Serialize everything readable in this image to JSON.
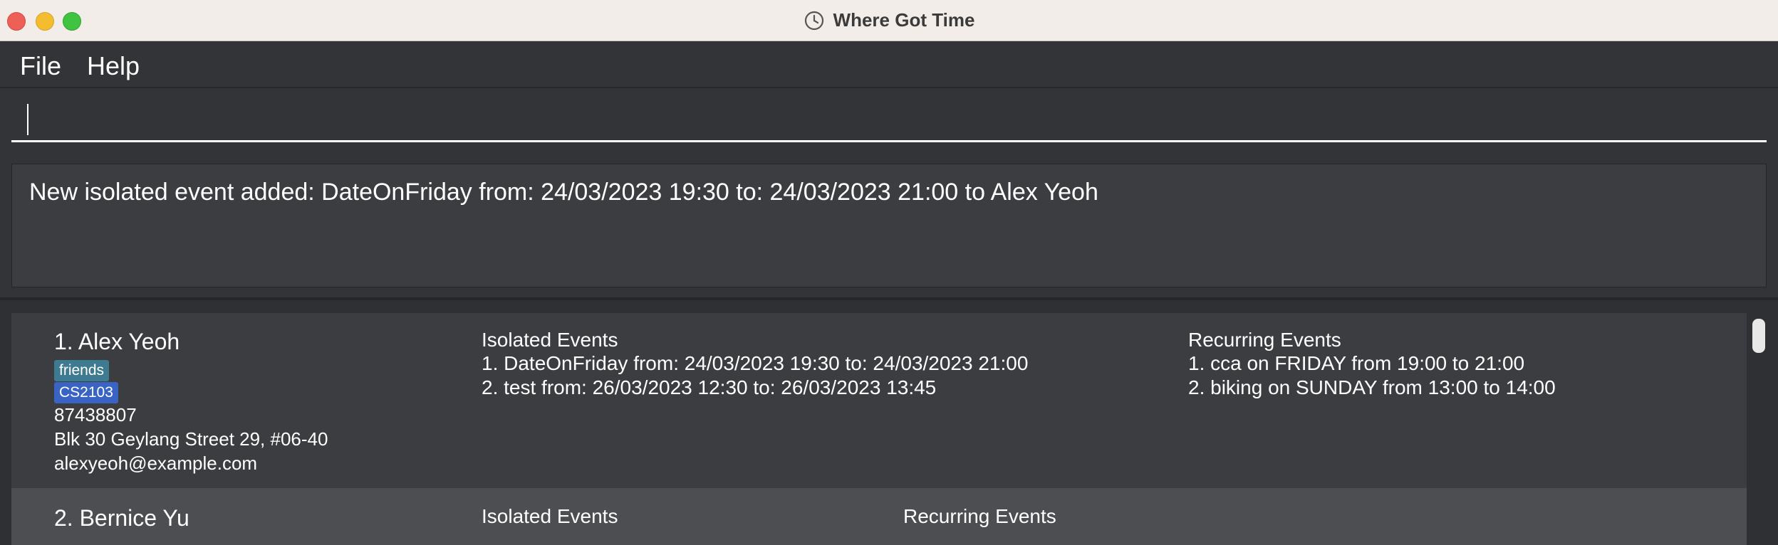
{
  "window": {
    "title": "Where Got Time",
    "icon": "clock-icon",
    "controls": [
      "close",
      "minimize",
      "maximize"
    ]
  },
  "menu": {
    "file": "File",
    "help": "Help"
  },
  "command": {
    "value": ""
  },
  "result": {
    "message": "New isolated event added: DateOnFriday from: 24/03/2023 19:30 to: 24/03/2023 21:00 to Alex Yeoh"
  },
  "persons": [
    {
      "name": "1. Alex Yeoh",
      "tags": [
        "friends",
        "CS2103"
      ],
      "phone": "87438807",
      "address": "Blk 30 Geylang Street 29, #06-40",
      "email": "alexyeoh@example.com",
      "isolated_title": "Isolated Events",
      "isolated_events": [
        "1. DateOnFriday from: 24/03/2023 19:30 to: 24/03/2023 21:00",
        "2. test from: 26/03/2023 12:30 to: 26/03/2023 13:45"
      ],
      "recurring_title": "Recurring Events",
      "recurring_events": [
        "1. cca on FRIDAY from 19:00 to 21:00",
        "2. biking on SUNDAY from 13:00 to 14:00"
      ]
    },
    {
      "name": "2. Bernice Yu",
      "isolated_title": "Isolated Events",
      "recurring_title": "Recurring Events"
    }
  ],
  "colors": {
    "background": "#2f3033",
    "card": "#3c3d40",
    "card_selected": "#4c4e52",
    "tag_friends": "#3e7b91",
    "tag_cs2103": "#3964c4",
    "close": "#ee5f57",
    "minimize": "#f4bc2f",
    "maximize": "#3fc340"
  }
}
